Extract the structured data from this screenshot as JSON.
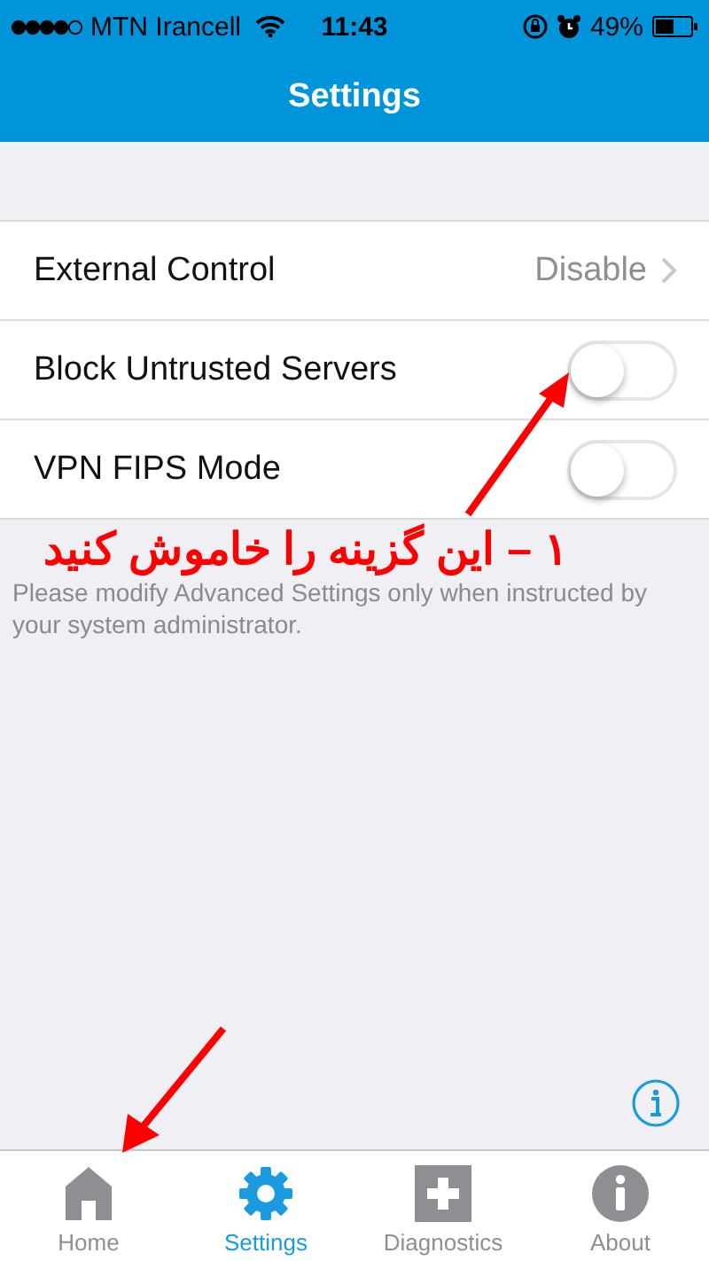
{
  "status_bar": {
    "carrier": "MTN Irancell",
    "time": "11:43",
    "battery": "49%"
  },
  "nav": {
    "title": "Settings"
  },
  "rows": [
    {
      "kind": "disclosure",
      "label": "External Control",
      "value": "Disable"
    },
    {
      "kind": "toggle",
      "label": "Block Untrusted Servers",
      "on": false
    },
    {
      "kind": "toggle",
      "label": "VPN FIPS Mode",
      "on": false
    }
  ],
  "annotations": [
    {
      "text": "۱ – این گزینه را خاموش کنید"
    }
  ],
  "footer_note": "Please modify Advanced Settings only when instructed by your system administrator.",
  "tabs": [
    {
      "kind": "home",
      "label": "Home",
      "selected": false
    },
    {
      "kind": "settings",
      "label": "Settings",
      "selected": true
    },
    {
      "kind": "diagnostics",
      "label": "Diagnostics",
      "selected": false
    },
    {
      "kind": "about",
      "label": "About",
      "selected": false
    }
  ]
}
